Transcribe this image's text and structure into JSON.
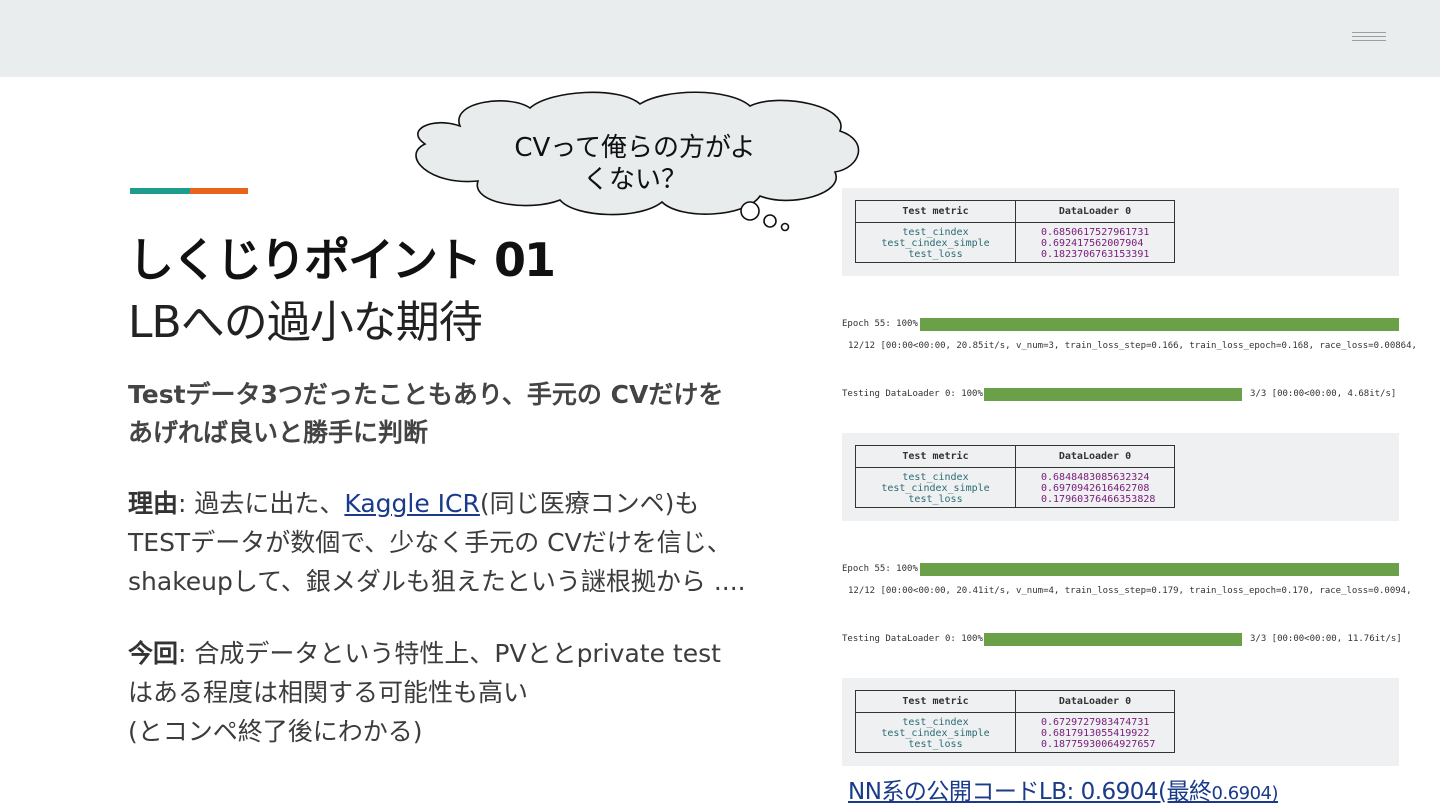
{
  "title": "しくじりポイント 01",
  "subtitle": "LBへの過小な期待",
  "speech_bubble": {
    "line1": "CVって俺らの方がよ",
    "line2": "くない？"
  },
  "lead": {
    "line1": "Testデータ3つだったこともあり、手元の CVだけを",
    "line2": "あげれば良いと勝手に判断"
  },
  "reason": {
    "label": "理由",
    "pre_link": ": 過去に出た、",
    "link": "Kaggle ICR",
    "post_link": "(同じ医療コンペ)も",
    "line2": "TESTデータが数個で、少なく手元の CVだけを信じ、",
    "line3": "shakeupして、銀メダルも狙えたという謎根拠から ...."
  },
  "now": {
    "label": "今回",
    "line1": ": 合成データという特性上、PVととprivate test",
    "line2": "はある程度は相関する可能性も高い",
    "line3": "(とコンペ終了後にわかる)"
  },
  "metric_header": {
    "col1": "Test metric",
    "col2": "DataLoader 0"
  },
  "metric_names": [
    "test_cindex",
    "test_cindex_simple",
    "test_loss"
  ],
  "results": [
    {
      "values": [
        "0.6850617527961731",
        "0.692417562007904",
        "0.1823706763153391"
      ]
    },
    {
      "epoch_label": "Epoch 55: 100%",
      "epoch_stats": "12/12 [00:00<00:00, 20.85it/s, v_num=3, train_loss_step=0.166, train_loss_epoch=0.168, race_loss=0.00864,",
      "testing_label": "Testing DataLoader 0: 100%",
      "testing_stats": "3/3 [00:00<00:00,  4.68it/s]",
      "epoch_progress": 1.0,
      "testing_progress": 1.0,
      "values": [
        "0.6848483085632324",
        "0.6970942616462708",
        "0.17960376466353828"
      ]
    },
    {
      "epoch_label": "Epoch 55: 100%",
      "epoch_stats": "12/12 [00:00<00:00, 20.41it/s, v_num=4, train_loss_step=0.179, train_loss_epoch=0.170, race_loss=0.0094,",
      "testing_label": "Testing DataLoader 0: 100%",
      "testing_stats": "3/3 [00:00<00:00, 11.76it/s]",
      "epoch_progress": 1.0,
      "testing_progress": 1.0,
      "values": [
        "0.6729727983474731",
        "0.6817913055419922",
        "0.18775930064927657"
      ]
    }
  ],
  "footer": {
    "link_main": "NN系の公開コードLB: 0.6904(最終",
    "link_small": "0.6904)"
  },
  "colors": {
    "teal": "#1e9c8e",
    "orange": "#e8641b",
    "progress": "#6aa148",
    "link": "#1a3a8a"
  }
}
